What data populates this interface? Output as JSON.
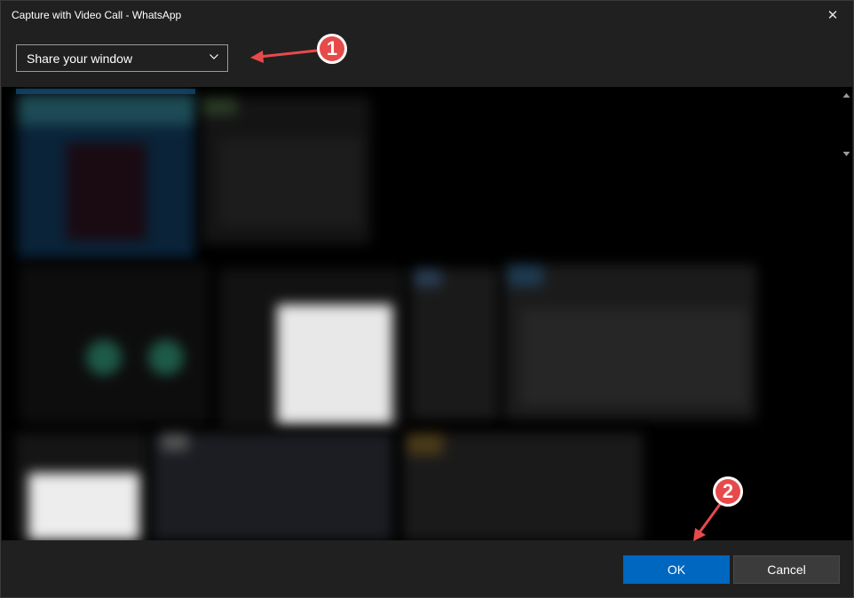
{
  "window": {
    "title": "Capture with Video Call - WhatsApp"
  },
  "icons": {
    "close": "close-icon",
    "dropdown": "chevron-down-icon"
  },
  "source_select": {
    "selected": "Share your window"
  },
  "buttons": {
    "ok": "OK",
    "cancel": "Cancel"
  },
  "annotations": [
    {
      "label": "1"
    },
    {
      "label": "2"
    }
  ],
  "colors": {
    "accent": "#0067c0",
    "annotation": "#e74a4a",
    "background": "#202020"
  }
}
